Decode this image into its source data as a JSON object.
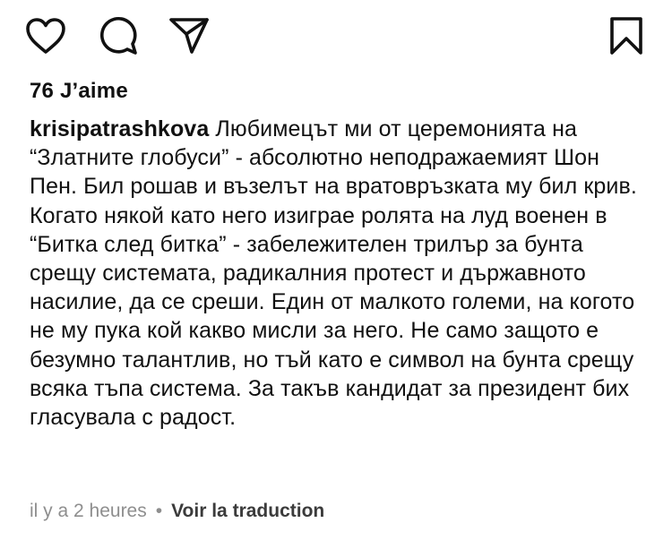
{
  "actions": {
    "like_icon": "heart-icon",
    "comment_icon": "comment-icon",
    "share_icon": "paper-plane-icon",
    "save_icon": "bookmark-icon"
  },
  "likes": {
    "text": "76 J’aime"
  },
  "post": {
    "username": "krisipatrashkova",
    "caption": "Любимецът ми от церемонията на “Златните глобуси” - абсолютно неподражаемият Шон Пен. Бил рошав и възелът на вратовръзката му бил крив. Когато някой като него изиграе ролята на луд военен в “Битка след битка” - забележителен трилър за бунта срещу системата, радикалния протест и държавното насилие, да се среши. Един от малкото големи, на когото не му пука кой какво мисли за него. Не само защото е безумно талантлив, но тъй като е символ на бунта срещу всяка тъпа система. За такъв кандидат за президент бих гласувала с радост."
  },
  "meta": {
    "time": "il y a 2 heures",
    "separator": "•",
    "translate": "Voir la traduction"
  }
}
